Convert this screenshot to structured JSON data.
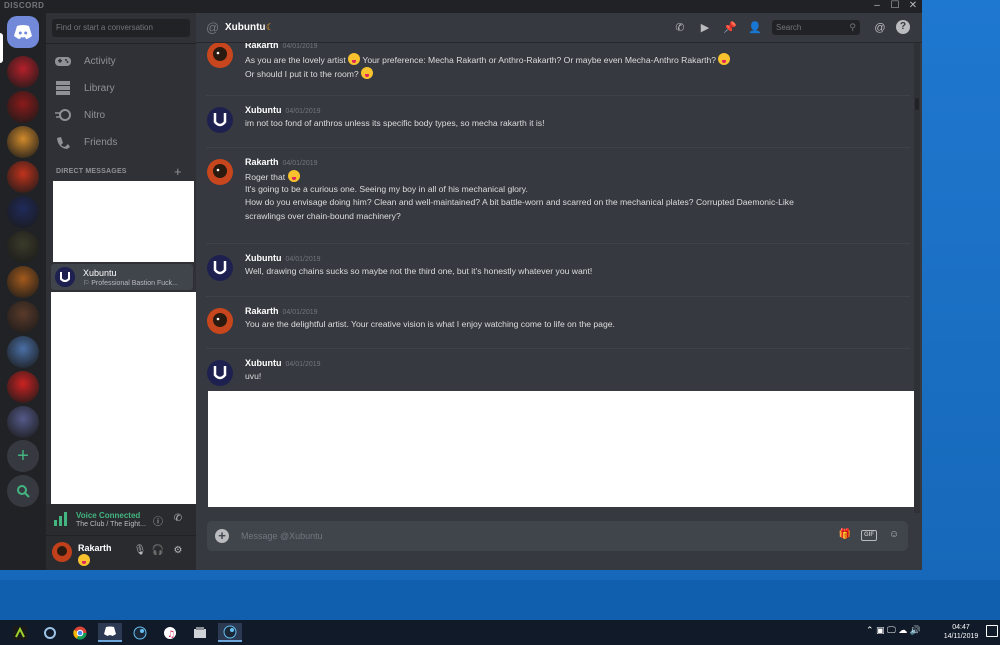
{
  "window": {
    "title": "DISCORD",
    "controls": [
      "–",
      "☐",
      "✕"
    ]
  },
  "servers": [
    {
      "color": "#b5202a"
    },
    {
      "color": "#8b1a1a"
    },
    {
      "color": "#d08a2c"
    },
    {
      "color": "#c0331c"
    },
    {
      "color": "#1f2a5a"
    },
    {
      "color": "#3a3a2a"
    },
    {
      "color": "#a35a1c"
    },
    {
      "color": "#5a3a2a"
    },
    {
      "color": "#4a6fa5"
    },
    {
      "color": "#c22"
    },
    {
      "color": "#555a8a"
    }
  ],
  "sidebar": {
    "search_placeholder": "Find or start a conversation",
    "nav": [
      {
        "label": "Activity",
        "icon": "controller-icon"
      },
      {
        "label": "Library",
        "icon": "library-icon"
      },
      {
        "label": "Nitro",
        "icon": "nitro-icon"
      },
      {
        "label": "Friends",
        "icon": "friends-icon"
      }
    ],
    "dm_header": "DIRECT MESSAGES",
    "dm_add": "+",
    "dm": {
      "name": "Xubuntu",
      "status": "Professional Bastion Fuck..."
    }
  },
  "voice": {
    "status": "Voice Connected",
    "channel": "The Club / The Eight..."
  },
  "user": {
    "name": "Rakarth"
  },
  "header": {
    "name": "Xubuntu",
    "search_placeholder": "Search"
  },
  "messages": [
    {
      "author": "Rakarth",
      "time": "04/01/2019",
      "lines": [
        {
          "text": "As you are the lovely artist",
          "emoji_after": true,
          "cont": " Your preference: Mecha Rakarth or Anthro-Rakarth? Or maybe even Mecha-Anthro Rakarth?",
          "emoji_end": true
        },
        {
          "text": "Or should I put it to the room?",
          "emoji_after": true
        }
      ]
    },
    {
      "author": "Xubuntu",
      "time": "04/01/2019",
      "lines": [
        {
          "text": "im not too fond of anthros unless its specific body types, so mecha rakarth it is!"
        }
      ]
    },
    {
      "author": "Rakarth",
      "time": "04/01/2019",
      "lines": [
        {
          "text": "Roger that",
          "emoji_after": true
        },
        {
          "text": "It's going to be a curious one. Seeing my boy in all of his mechanical glory."
        },
        {
          "text": "How do you envisage doing him? Clean and well-maintained? A bit battle-worn and scarred on the mechanical plates? Corrupted Daemonic-Like"
        },
        {
          "text": "scrawlings over chain-bound machinery?"
        }
      ]
    },
    {
      "author": "Xubuntu",
      "time": "04/01/2019",
      "lines": [
        {
          "text": "Well, drawing chains sucks so maybe not the third one, but it's honestly whatever you want!"
        }
      ]
    },
    {
      "author": "Rakarth",
      "time": "04/01/2019",
      "lines": [
        {
          "text": "You are the delightful artist. Your creative vision is what I enjoy watching come to life on the page."
        }
      ]
    },
    {
      "author": "Xubuntu",
      "time": "04/01/2019",
      "lines": [
        {
          "text": "uvu!"
        }
      ]
    }
  ],
  "composer": {
    "placeholder": "Message @Xubuntu",
    "gif": "GIF"
  },
  "taskbar": {
    "time": "04:47",
    "date": "14/11/2019"
  },
  "colors": {
    "accent": "#7289da",
    "online": "#43b581",
    "idle": "#faa61a"
  }
}
